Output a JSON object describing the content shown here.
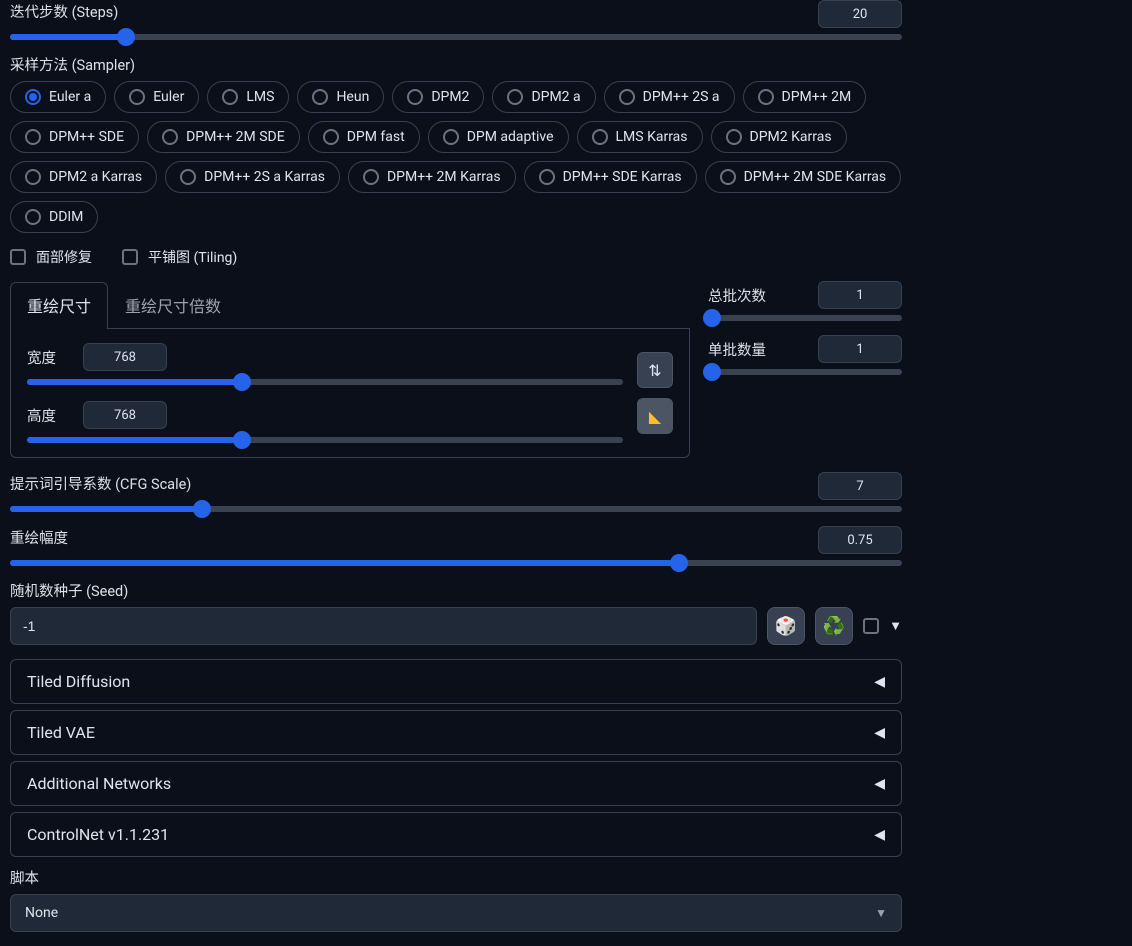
{
  "steps": {
    "label": "迭代步数 (Steps)",
    "value": "20",
    "fill_pct": 13
  },
  "sampler": {
    "label": "采样方法 (Sampler)",
    "options": [
      "Euler a",
      "Euler",
      "LMS",
      "Heun",
      "DPM2",
      "DPM2 a",
      "DPM++ 2S a",
      "DPM++ 2M",
      "DPM++ SDE",
      "DPM++ 2M SDE",
      "DPM fast",
      "DPM adaptive",
      "LMS Karras",
      "DPM2 Karras",
      "DPM2 a Karras",
      "DPM++ 2S a Karras",
      "DPM++ 2M Karras",
      "DPM++ SDE Karras",
      "DPM++ 2M SDE Karras",
      "DDIM"
    ],
    "selected": "Euler a"
  },
  "checks": {
    "face_restore": "面部修复",
    "tiling": "平铺图 (Tiling)"
  },
  "resize_tabs": {
    "tab1": "重绘尺寸",
    "tab2": "重绘尺寸倍数"
  },
  "width": {
    "label": "宽度",
    "value": "768",
    "fill_pct": 36
  },
  "height": {
    "label": "高度",
    "value": "768",
    "fill_pct": 36
  },
  "swap_icon": "⇅",
  "ruler_icon": "📐",
  "batch_count": {
    "label": "总批次数",
    "value": "1",
    "fill_pct": 2
  },
  "batch_size": {
    "label": "单批数量",
    "value": "1",
    "fill_pct": 2
  },
  "cfg": {
    "label": "提示词引导系数 (CFG Scale)",
    "value": "7",
    "fill_pct": 21.5
  },
  "denoise": {
    "label": "重绘幅度",
    "value": "0.75",
    "fill_pct": 75
  },
  "seed": {
    "label": "随机数种子 (Seed)",
    "value": "-1"
  },
  "dice_icon": "🎲",
  "recycle_icon": "♻️",
  "accordions": [
    "Tiled Diffusion",
    "Tiled VAE",
    "Additional Networks",
    "ControlNet v1.1.231"
  ],
  "script": {
    "label": "脚本",
    "selected": "None"
  }
}
